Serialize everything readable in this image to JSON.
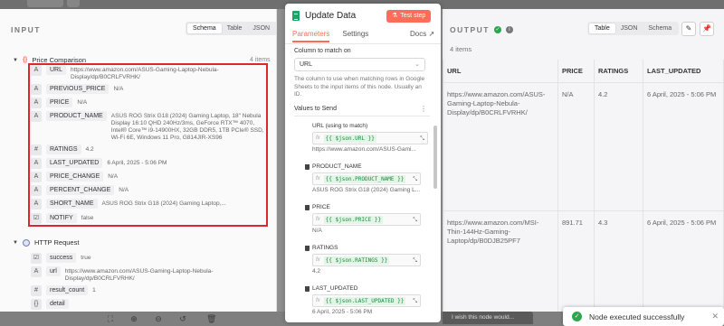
{
  "input": {
    "title": "INPUT",
    "view_tabs": [
      "Schema",
      "Table",
      "JSON"
    ],
    "active_view": "Schema",
    "group": {
      "name": "Price Comparison",
      "count": "4 items",
      "fields": [
        {
          "type": "A",
          "name": "URL",
          "value": "https://www.amazon.com/ASUS-Gaming-Laptop-Nebula-Display/dp/B0CRLFVRHK/"
        },
        {
          "type": "A",
          "name": "PREVIOUS_PRICE",
          "value": "N/A"
        },
        {
          "type": "A",
          "name": "PRICE",
          "value": "N/A"
        },
        {
          "type": "A",
          "name": "PRODUCT_NAME",
          "value": "ASUS ROG Strix G18 (2024) Gaming Laptop, 18\" Nebula Display 16:10 QHD 240Hz/3ms, GeForce RTX™ 4070, Intel® Core™ i9-14900HX, 32GB DDR5, 1TB PCIe® SSD, Wi-Fi 6E, Windows 11 Pro, G814JIR-XS96"
        },
        {
          "type": "#",
          "name": "RATINGS",
          "value": "4.2"
        },
        {
          "type": "A",
          "name": "LAST_UPDATED",
          "value": "6 April, 2025 - 5:06 PM"
        },
        {
          "type": "A",
          "name": "PRICE_CHANGE",
          "value": "N/A"
        },
        {
          "type": "A",
          "name": "PERCENT_CHANGE",
          "value": "N/A"
        },
        {
          "type": "A",
          "name": "SHORT_NAME",
          "value": "ASUS ROG Strix G18 (2024) Gaming Laptop,..."
        }
      ],
      "notify": {
        "type": "☑",
        "name": "NOTIFY",
        "value": "false"
      }
    },
    "http": {
      "name": "HTTP Request",
      "fields": [
        {
          "type": "☑",
          "name": "success",
          "value": "true"
        },
        {
          "type": "A",
          "name": "url",
          "value": "https://www.amazon.com/ASUS-Gaming-Laptop-Nebula-Display/dp/B0CRLFVRHK/"
        },
        {
          "type": "#",
          "name": "result_count",
          "value": "1"
        },
        {
          "type": "{}",
          "name": "detail",
          "value": ""
        }
      ]
    }
  },
  "center": {
    "title": "Update Data",
    "test_step": "Test step",
    "tabs": [
      "Parameters",
      "Settings"
    ],
    "docs": "Docs",
    "column_match_label": "Column to match on",
    "column_match_value": "URL",
    "help": "The column to use when matching rows in Google Sheets to the input items of this node. Usually an ID.",
    "values_label": "Values to Send",
    "values": [
      {
        "name": "URL (using to match)",
        "expr": "{{ $json.URL }}",
        "preview": "https://www.amazon.com/ASUS-Gami...",
        "deletable": false
      },
      {
        "name": "PRODUCT_NAME",
        "expr": "{{ $json.PRODUCT_NAME }}",
        "preview": "ASUS ROG Strix G18 (2024) Gaming L...",
        "deletable": true
      },
      {
        "name": "PRICE",
        "expr": "{{ $json.PRICE }}",
        "preview": "N/A",
        "deletable": true
      },
      {
        "name": "RATINGS",
        "expr": "{{ $json.RATINGS }}",
        "preview": "4.2",
        "deletable": true
      },
      {
        "name": "LAST_UPDATED",
        "expr": "{{ $json.LAST_UPDATED }}",
        "preview": "6 April, 2025 - 5:06 PM",
        "deletable": true
      }
    ],
    "wish": "I wish this node would..."
  },
  "output": {
    "title": "OUTPUT",
    "view_tabs": [
      "Table",
      "JSON",
      "Schema"
    ],
    "active_view": "Table",
    "items_count": "4 items",
    "columns": [
      "URL",
      "PRICE",
      "RATINGS",
      "LAST_UPDATED"
    ],
    "rows": [
      [
        "https://www.amazon.com/ASUS-Gaming-Laptop-Nebula-Display/dp/B0CRLFVRHK/",
        "N/A",
        "4.2",
        "6 April, 2025 - 5:06 PM"
      ],
      [
        "https://www.amazon.com/MSI-Thin-144Hz-Gaming-Laptop/dp/B0DJB25PF7",
        "891.71",
        "4.3",
        "6 April, 2025 - 5:06 PM"
      ]
    ]
  },
  "toast": "Node executed successfully"
}
